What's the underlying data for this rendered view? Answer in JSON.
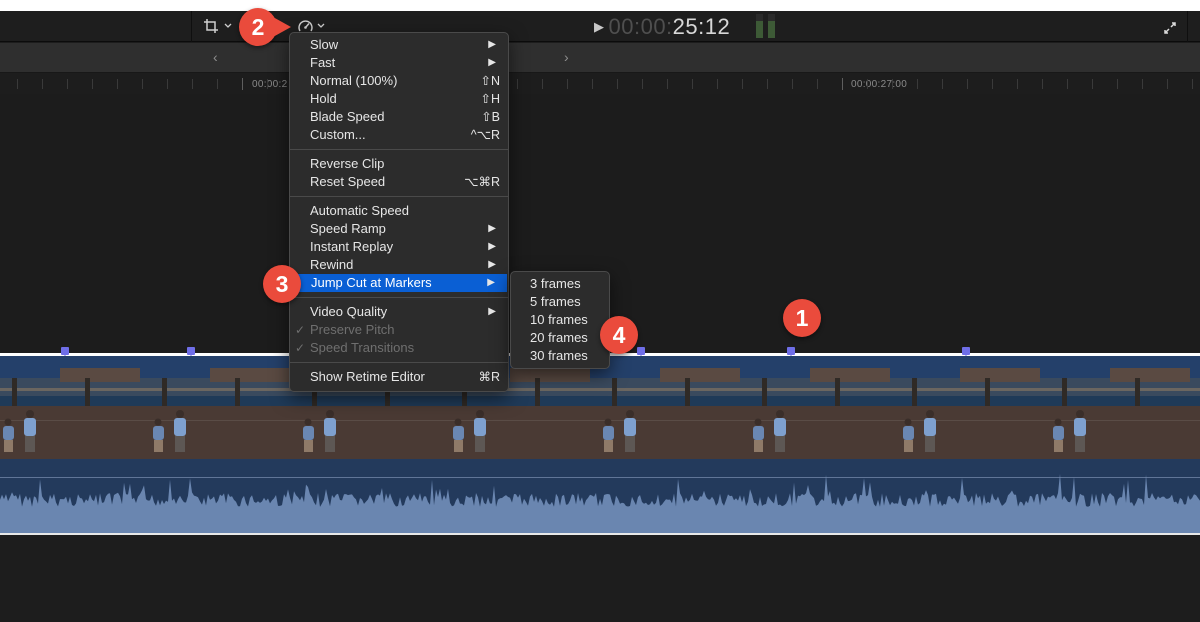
{
  "toolbar": {
    "crop_tool": {
      "icon": "crop-icon",
      "chevron": "chevron-down-icon"
    },
    "retime_tool": {
      "icon": "speedometer-icon",
      "chevron": "chevron-down-icon"
    },
    "timecode": {
      "play_icon": "▶",
      "dim_part": "00:00:",
      "bright_part": "25:12"
    },
    "audio_meters": {
      "left_level": 0.7,
      "right_level": 0.7,
      "color": "#3d5a36"
    },
    "fullscreen_icon": "expand-arrows-icon"
  },
  "nav": {
    "back_label": "‹",
    "forward_label": "›"
  },
  "ruler": {
    "labels": [
      {
        "text": "00:00:2"
      },
      {
        "text": "00:00:27:00"
      }
    ]
  },
  "retime_menu": {
    "groups": [
      [
        {
          "label": "Slow",
          "submenu": true
        },
        {
          "label": "Fast",
          "submenu": true
        },
        {
          "label": "Normal (100%)",
          "shortcut": "⇧N"
        },
        {
          "label": "Hold",
          "shortcut": "⇧H"
        },
        {
          "label": "Blade Speed",
          "shortcut": "⇧B"
        },
        {
          "label": "Custom...",
          "shortcut": "^⌥R"
        }
      ],
      [
        {
          "label": "Reverse Clip"
        },
        {
          "label": "Reset Speed",
          "shortcut": "⌥⌘R"
        }
      ],
      [
        {
          "label": "Automatic Speed"
        },
        {
          "label": "Speed Ramp",
          "submenu": true
        },
        {
          "label": "Instant Replay",
          "submenu": true
        },
        {
          "label": "Rewind",
          "submenu": true
        },
        {
          "label": "Jump Cut at Markers",
          "submenu": true,
          "selected": true
        }
      ],
      [
        {
          "label": "Video Quality",
          "submenu": true
        },
        {
          "label": "Preserve Pitch",
          "checked": true,
          "disabled": true
        },
        {
          "label": "Speed Transitions",
          "checked": true,
          "disabled": true
        }
      ],
      [
        {
          "label": "Show Retime Editor",
          "shortcut": "⌘R"
        }
      ]
    ],
    "arrow_glyph": "▶",
    "check_glyph": "✓"
  },
  "jump_cut_submenu": {
    "items": [
      "3 frames",
      "5 frames",
      "10 frames",
      "20 frames",
      "30 frames"
    ]
  },
  "callouts": [
    {
      "number": "1"
    },
    {
      "number": "2"
    },
    {
      "number": "3"
    },
    {
      "number": "4"
    }
  ],
  "colors": {
    "accent_selected": "#0a5fd4",
    "marker": "#6f6ee8",
    "callout": "#ea4b3c",
    "audio_wave": "#6a86b0"
  }
}
